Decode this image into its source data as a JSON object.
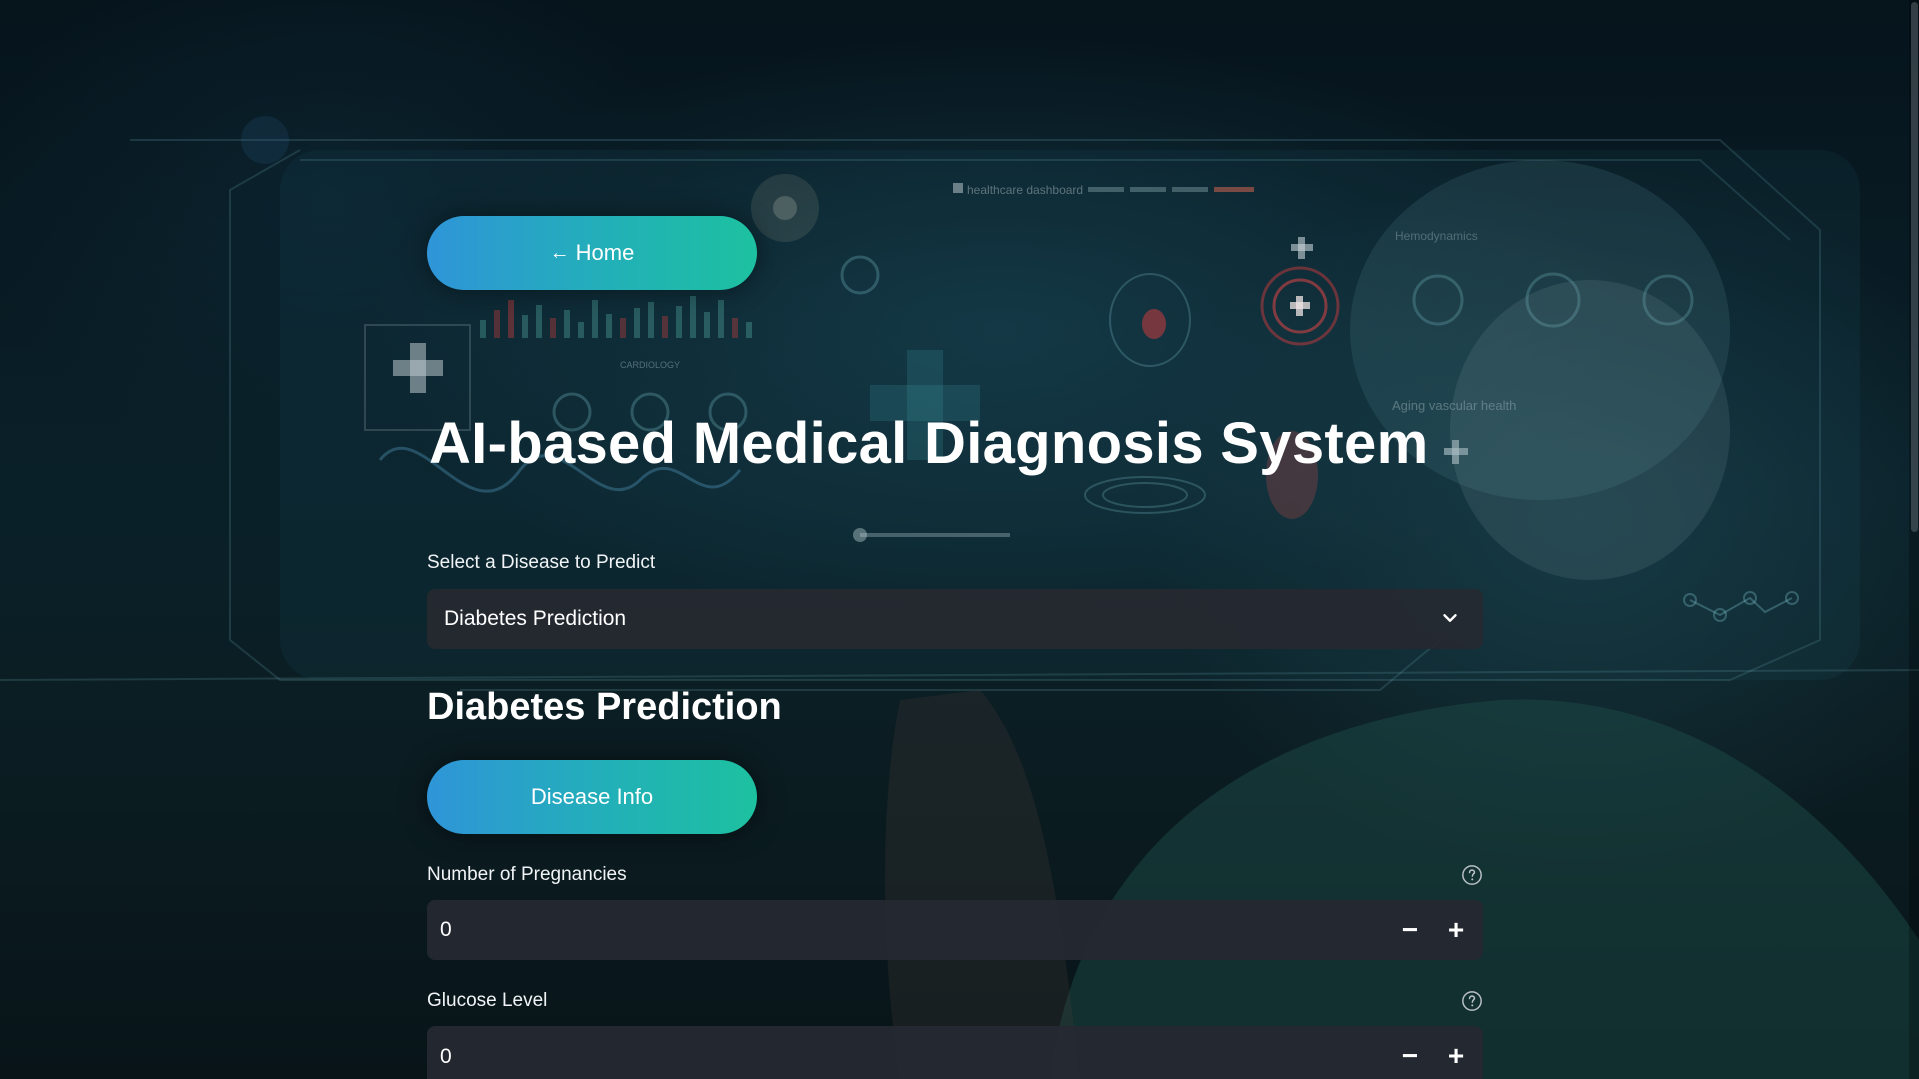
{
  "nav": {
    "home_arrow": "←",
    "home_label": "Home"
  },
  "page": {
    "title": "AI-based Medical Diagnosis System"
  },
  "disease_select": {
    "label": "Select a Disease to Predict",
    "selected_value": "Diabetes Prediction"
  },
  "section": {
    "heading": "Diabetes Prediction",
    "info_button_label": "Disease Info"
  },
  "fields": [
    {
      "label": "Number of Pregnancies",
      "value": "0",
      "minus": "−",
      "plus": "+"
    },
    {
      "label": "Glucose Level",
      "value": "0",
      "minus": "−",
      "plus": "+"
    }
  ],
  "background": {
    "dashboard_caption": "healthcare dashboard",
    "cardiology_caption": "CARDIOLOGY",
    "vascular_caption": "Aging vascular health",
    "hemodynamics_caption": "Hemodynamics",
    "accent_teal": "#1dc1a0",
    "accent_blue": "#2f95d8"
  },
  "icons": {
    "select_chevron": "chevron-down-icon",
    "help": "question-circle-icon"
  }
}
